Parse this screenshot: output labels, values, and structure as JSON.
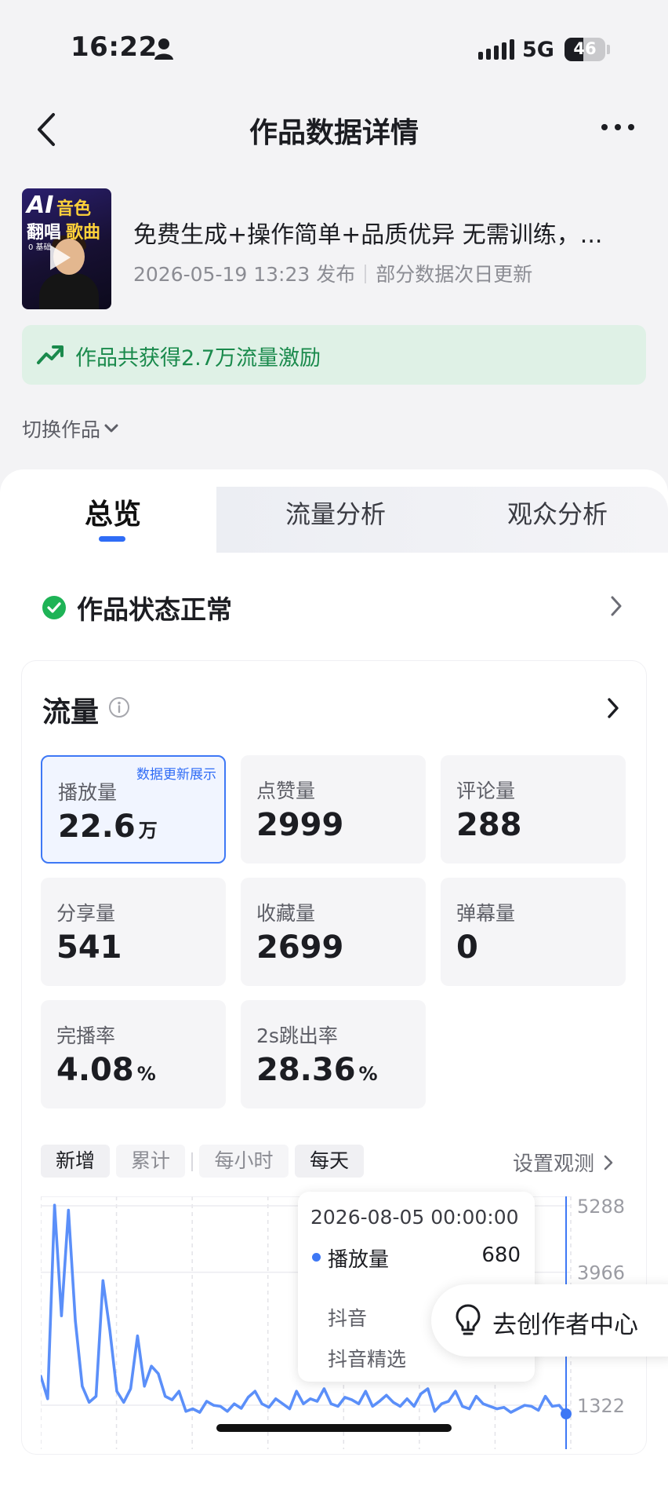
{
  "status_bar": {
    "time": "16:22",
    "network": "5G",
    "battery": "46"
  },
  "header": {
    "title": "作品数据详情"
  },
  "video": {
    "title": "免费生成+操作简单+品质优异 无需训练，...",
    "publish_info": "2026-05-19 13:23 发布",
    "update_note": "部分数据次日更新",
    "thumb_text": {
      "ai": "AI",
      "line1": "音色",
      "line2a": "翻唱",
      "line2b": "歌曲",
      "small": "0 基础"
    }
  },
  "banner": {
    "text": "作品共获得2.7万流量激励",
    "color": "#1a8a4c"
  },
  "switch_label": "切换作品",
  "tabs": [
    "总览",
    "流量分析",
    "观众分析"
  ],
  "status": {
    "text": "作品状态正常"
  },
  "flow": {
    "title": "流量",
    "stats": [
      {
        "label": "播放量",
        "value": "22.6",
        "unit": "万",
        "tag": "数据更新展示"
      },
      {
        "label": "点赞量",
        "value": "2999",
        "unit": ""
      },
      {
        "label": "评论量",
        "value": "288",
        "unit": ""
      },
      {
        "label": "分享量",
        "value": "541",
        "unit": ""
      },
      {
        "label": "收藏量",
        "value": "2699",
        "unit": ""
      },
      {
        "label": "弹幕量",
        "value": "0",
        "unit": ""
      },
      {
        "label": "完播率",
        "value": "4.08",
        "unit": "%"
      },
      {
        "label": "2s跳出率",
        "value": "28.36",
        "unit": "%"
      }
    ],
    "segments": [
      "新增",
      "累计",
      "每小时",
      "每天"
    ],
    "observe_label": "设置观测"
  },
  "chart_data": {
    "type": "line",
    "series": [
      {
        "name": "播放量",
        "values": [
          1900,
          1450,
          5300,
          3100,
          5200,
          3000,
          1700,
          1380,
          1500,
          3800,
          2800,
          1600,
          1380,
          1650,
          2700,
          1700,
          2100,
          1950,
          1500,
          1430,
          1600,
          1200,
          1250,
          1180,
          1400,
          1320,
          1300,
          1200,
          1350,
          1260,
          1480,
          1600,
          1350,
          1280,
          1450,
          1350,
          1250,
          1600,
          1350,
          1450,
          1400,
          1650,
          1350,
          1300,
          1480,
          1430,
          1350,
          1600,
          1300,
          1400,
          1520,
          1380,
          1300,
          1450,
          1300,
          1550,
          1650,
          1200,
          1350,
          1400,
          1600,
          1300,
          1250,
          1500,
          1350,
          1300,
          1250,
          1280,
          1180,
          1250,
          1320,
          1300,
          1220,
          1500,
          1300,
          1320,
          1150
        ]
      }
    ],
    "y_ticks": [
      "5288",
      "3966",
      "1322"
    ],
    "tooltip": {
      "date": "2026-08-05 00:00:00",
      "series": "播放量",
      "value": "680",
      "sources": [
        "抖音",
        "抖音精选"
      ]
    },
    "color": "#5b8ff9"
  },
  "floating_button": {
    "label": "去创作者中心"
  }
}
